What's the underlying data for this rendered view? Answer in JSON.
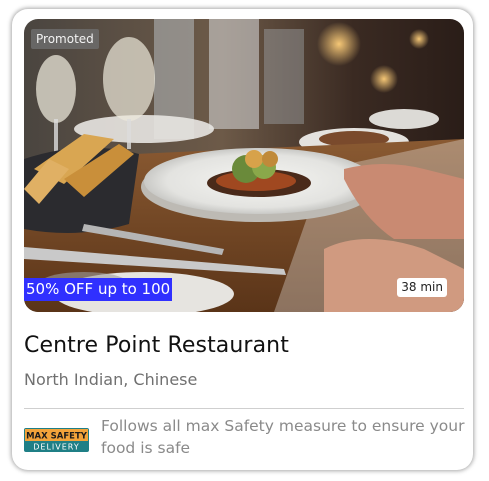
{
  "card": {
    "badge": "Promoted",
    "offer": "50% OFF up to 100",
    "delivery_time": "38 min",
    "restaurant_name": "Centre Point Restaurant",
    "cuisines": "North Indian, Chinese",
    "safety": {
      "badge_line1": "MAX SAFETY",
      "badge_line2": "DELIVERY",
      "message": "Follows all max Safety measure to ensure your food is safe"
    }
  },
  "colors": {
    "offer_bg": "#3030ff",
    "safety_badge_top": "#f2a33a",
    "safety_badge_bottom": "#1f7f86"
  }
}
